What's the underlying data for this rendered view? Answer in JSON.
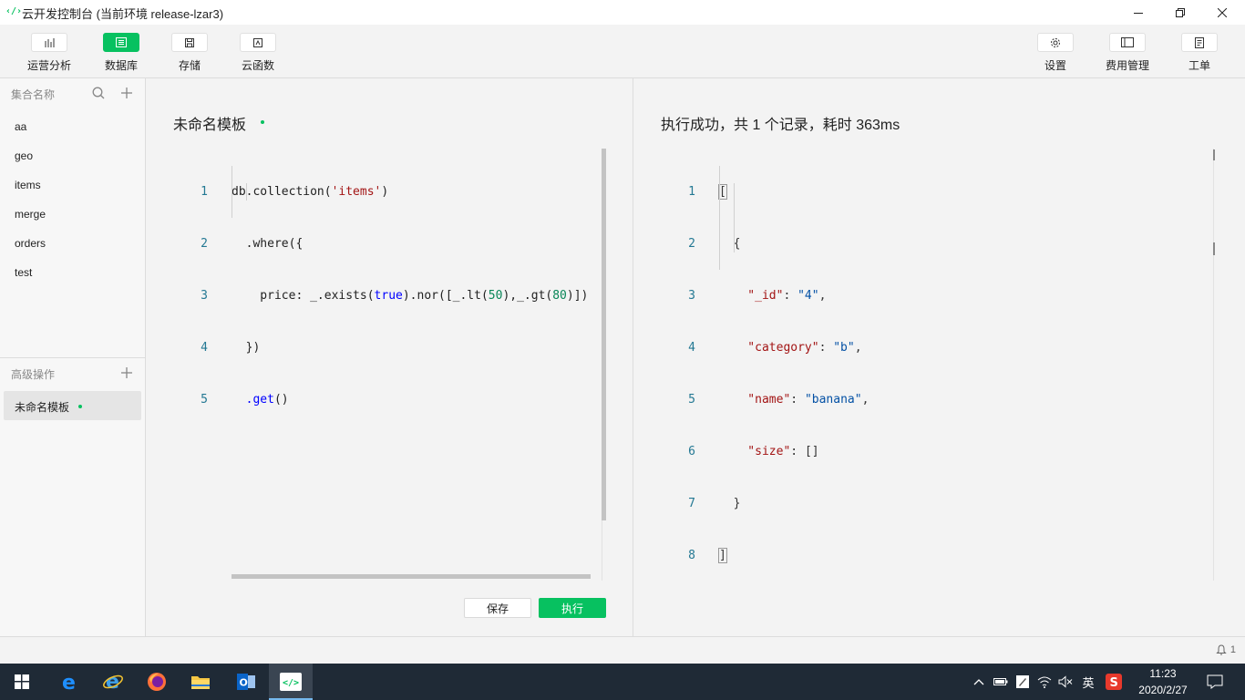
{
  "window": {
    "title": "云开发控制台 (当前环境 release-lzar3)",
    "icon": "code-icon"
  },
  "toolbar": {
    "left": [
      {
        "label": "运营分析",
        "icon": "bar-chart-icon"
      },
      {
        "label": "数据库",
        "icon": "database-icon",
        "active": true
      },
      {
        "label": "存储",
        "icon": "storage-icon"
      },
      {
        "label": "云函数",
        "icon": "function-icon"
      }
    ],
    "right": [
      {
        "label": "设置",
        "icon": "gear-icon"
      },
      {
        "label": "费用管理",
        "icon": "billing-icon"
      },
      {
        "label": "工单",
        "icon": "ticket-icon"
      }
    ]
  },
  "sidebar": {
    "collections_header": "集合名称",
    "collections": [
      "aa",
      "geo",
      "items",
      "merge",
      "orders",
      "test"
    ],
    "advanced_header": "高级操作",
    "templates": [
      "未命名模板"
    ]
  },
  "editor": {
    "title": "未命名模板",
    "line_numbers": [
      "1",
      "2",
      "3",
      "4",
      "5"
    ],
    "save_label": "保存",
    "run_label": "执行"
  },
  "result": {
    "title": "执行成功，共 1 个记录，耗时 363ms",
    "line_numbers": [
      "1",
      "2",
      "3",
      "4",
      "5",
      "6",
      "7",
      "8"
    ]
  },
  "statusbar": {
    "notification_count": "1"
  },
  "taskbar": {
    "ime": "英",
    "time": "11:23",
    "date": "2020/2/27"
  },
  "colors": {
    "accent": "#07c160",
    "line_number": "#237893",
    "taskbar": "#1f2a36"
  }
}
